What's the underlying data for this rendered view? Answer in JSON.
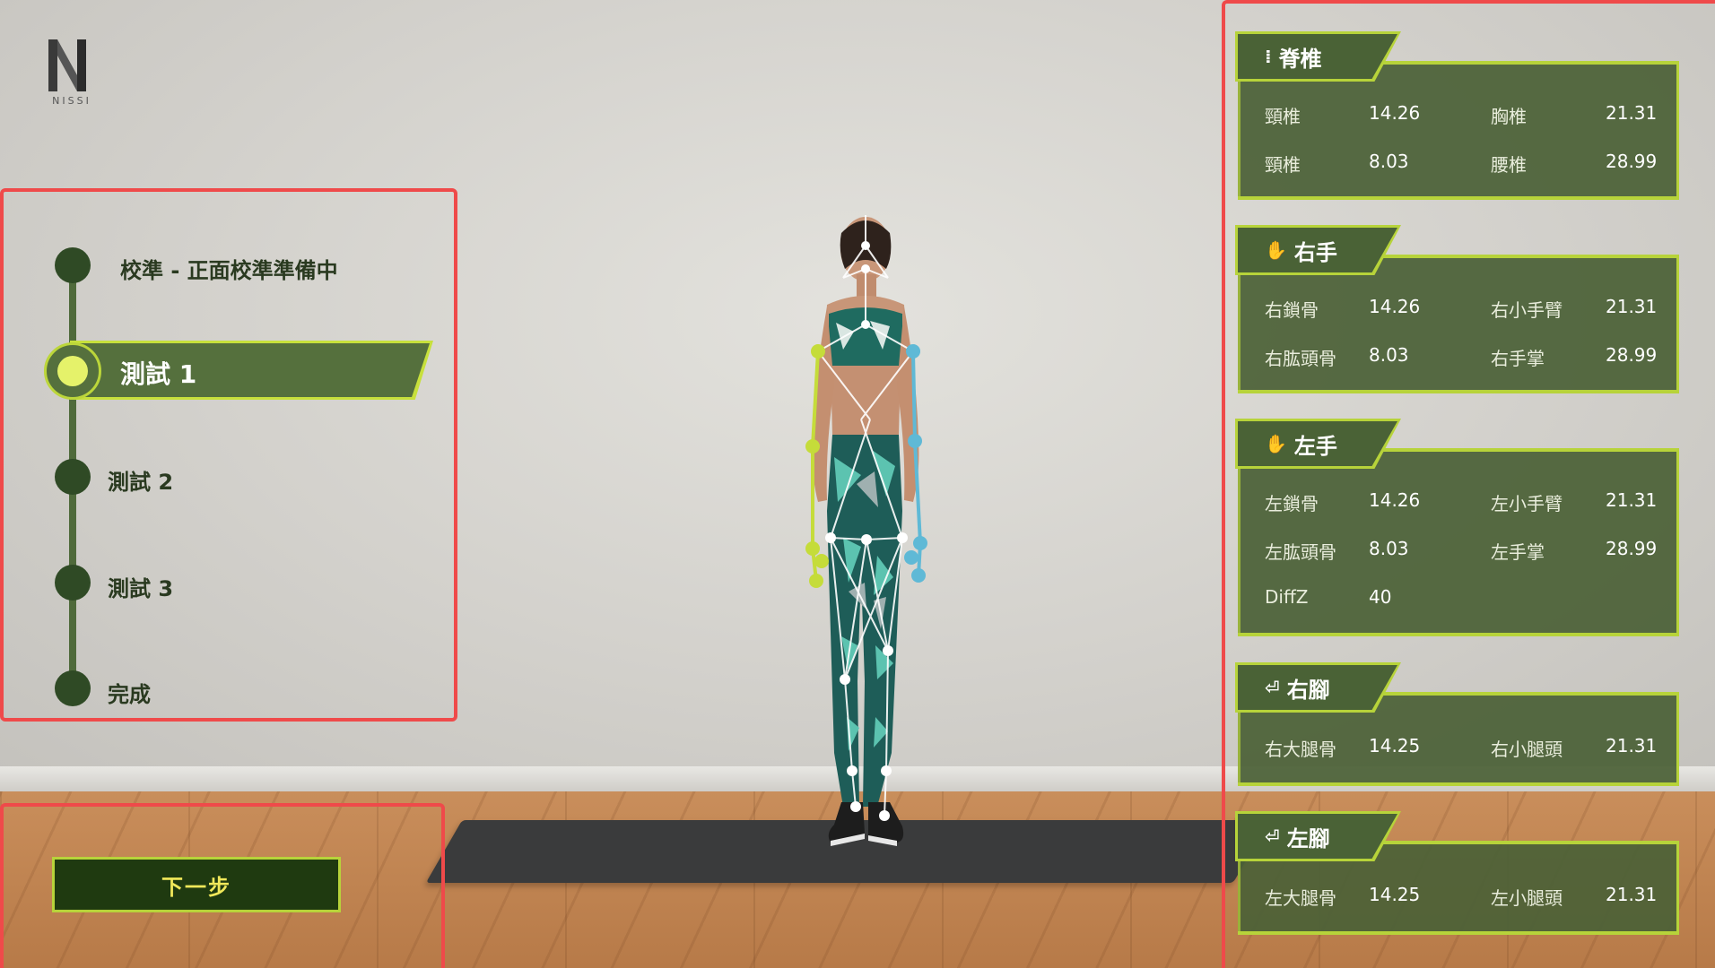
{
  "logo": {
    "text": "NISSI"
  },
  "steps": [
    {
      "label": "校準 - 正面校準準備中",
      "state": "pending"
    },
    {
      "label": "測試 1",
      "state": "active"
    },
    {
      "label": "測試 2",
      "state": "pending"
    },
    {
      "label": "測試 3",
      "state": "pending"
    },
    {
      "label": "完成",
      "state": "pending"
    }
  ],
  "next_button": {
    "label": "下一步"
  },
  "panels": {
    "spine": {
      "title": "脊椎",
      "icon": "spine-icon",
      "rows": [
        [
          "頸椎",
          "14.26",
          "胸椎",
          "21.31"
        ],
        [
          "頸椎",
          "8.03",
          "腰椎",
          "28.99"
        ]
      ]
    },
    "right_hand": {
      "title": "右手",
      "icon": "hand-icon",
      "rows": [
        [
          "右鎖骨",
          "14.26",
          "右小手臂",
          "21.31"
        ],
        [
          "右肱頭骨",
          "8.03",
          "右手掌",
          "28.99"
        ]
      ]
    },
    "left_hand": {
      "title": "左手",
      "icon": "hand-icon",
      "rows": [
        [
          "左鎖骨",
          "14.26",
          "左小手臂",
          "21.31"
        ],
        [
          "左肱頭骨",
          "8.03",
          "左手掌",
          "28.99"
        ],
        [
          "DiffZ",
          "40",
          "",
          ""
        ]
      ]
    },
    "right_foot": {
      "title": "右腳",
      "icon": "foot-icon",
      "rows": [
        [
          "右大腿骨",
          "14.25",
          "右小腿頭",
          "21.31"
        ]
      ]
    },
    "left_foot": {
      "title": "左腳",
      "icon": "foot-icon",
      "rows": [
        [
          "左大腿骨",
          "14.25",
          "左小腿頭",
          "21.31"
        ]
      ]
    }
  },
  "colors": {
    "accent": "#b7d33a",
    "panel": "#4b6137",
    "highlight_frame": "#ef4a4a",
    "skeleton_left": "#c5dc3a",
    "skeleton_right": "#5fb9d6"
  }
}
